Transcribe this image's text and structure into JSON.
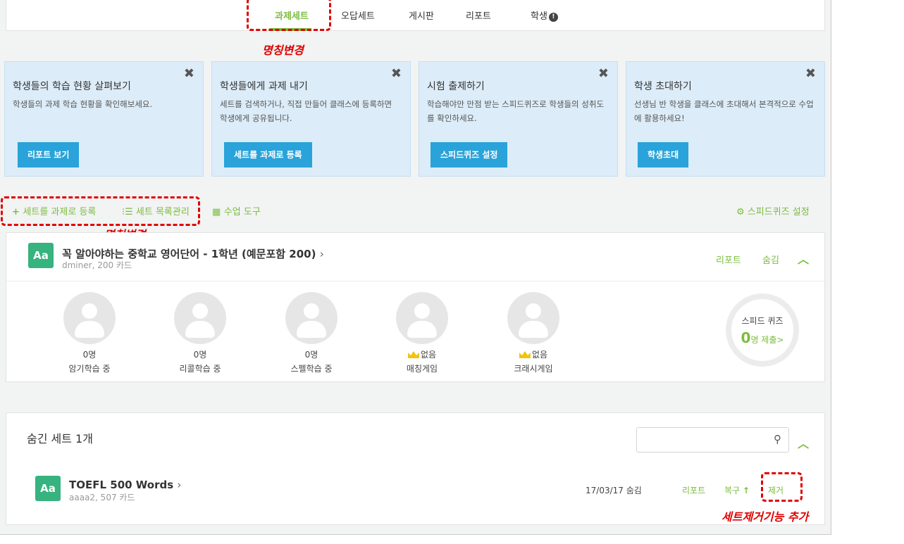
{
  "nav": {
    "tabs": [
      "과제세트",
      "오답세트",
      "게시판",
      "리포트",
      "학생"
    ],
    "active_index": 0
  },
  "annotations": {
    "rename_top": "명칭변경",
    "rename_tools": "명칭변경",
    "remove_feature": "세트제거기능 추가"
  },
  "cards": [
    {
      "title": "학생들의 학습 현황 살펴보기",
      "desc": "학생들의 과제 학습 현황을 확인해보세요.",
      "button": "리포트 보기"
    },
    {
      "title": "학생들에게 과제 내기",
      "desc": "세트를 검색하거나, 직접 만들어 클래스에 등록하면 학생에게 공유됩니다.",
      "button": "세트를 과제로 등록"
    },
    {
      "title": "시험 출제하기",
      "desc": "학습해야만 만점 받는 스피드퀴즈로 학생들의 성취도를 확인하세요.",
      "button": "스피드퀴즈 설정"
    },
    {
      "title": "학생 초대하기",
      "desc": "선생님 반 학생을 클래스에 초대해서 본격적으로 수업에 활용하세요!",
      "button": "학생초대"
    }
  ],
  "close_glyph": "✖",
  "toolbar": {
    "add_set": "세트를 과제로 등록",
    "manage_list": "세트 목록관리",
    "class_tools": "수업 도구",
    "speed_quiz_settings": "스피드퀴즈 설정"
  },
  "set1": {
    "badge": "Aa",
    "name": "꼭 알아야하는 중학교 영어단어 - 1학년 (예문포함 200)",
    "meta": "dminer, 200 카드",
    "report": "리포트",
    "hide": "숨김",
    "stats": [
      {
        "num": "0명",
        "label": "암기학습 중"
      },
      {
        "num": "0명",
        "label": "리콜학습 중"
      },
      {
        "num": "0명",
        "label": "스펠학습 중"
      },
      {
        "num": "없음",
        "label": "매칭게임"
      },
      {
        "num": "없음",
        "label": "크래시게임"
      }
    ],
    "quiz_title": "스피드 퀴즈",
    "quiz_count": "0",
    "quiz_suffix": "명 제출>"
  },
  "hidden": {
    "title": "숨긴 세트 1개",
    "search_placeholder": "",
    "set_badge": "Aa",
    "set_name": "TOEFL 500 Words",
    "set_meta": "aaaa2, 507 카드",
    "date": "17/03/17 숨김",
    "report": "리포트",
    "restore": "복구",
    "remove": "제거"
  },
  "colors": {
    "accent": "#7bbd3f",
    "button": "#29a3d9",
    "card_bg": "#dcecf8",
    "annotation": "#e00000"
  }
}
